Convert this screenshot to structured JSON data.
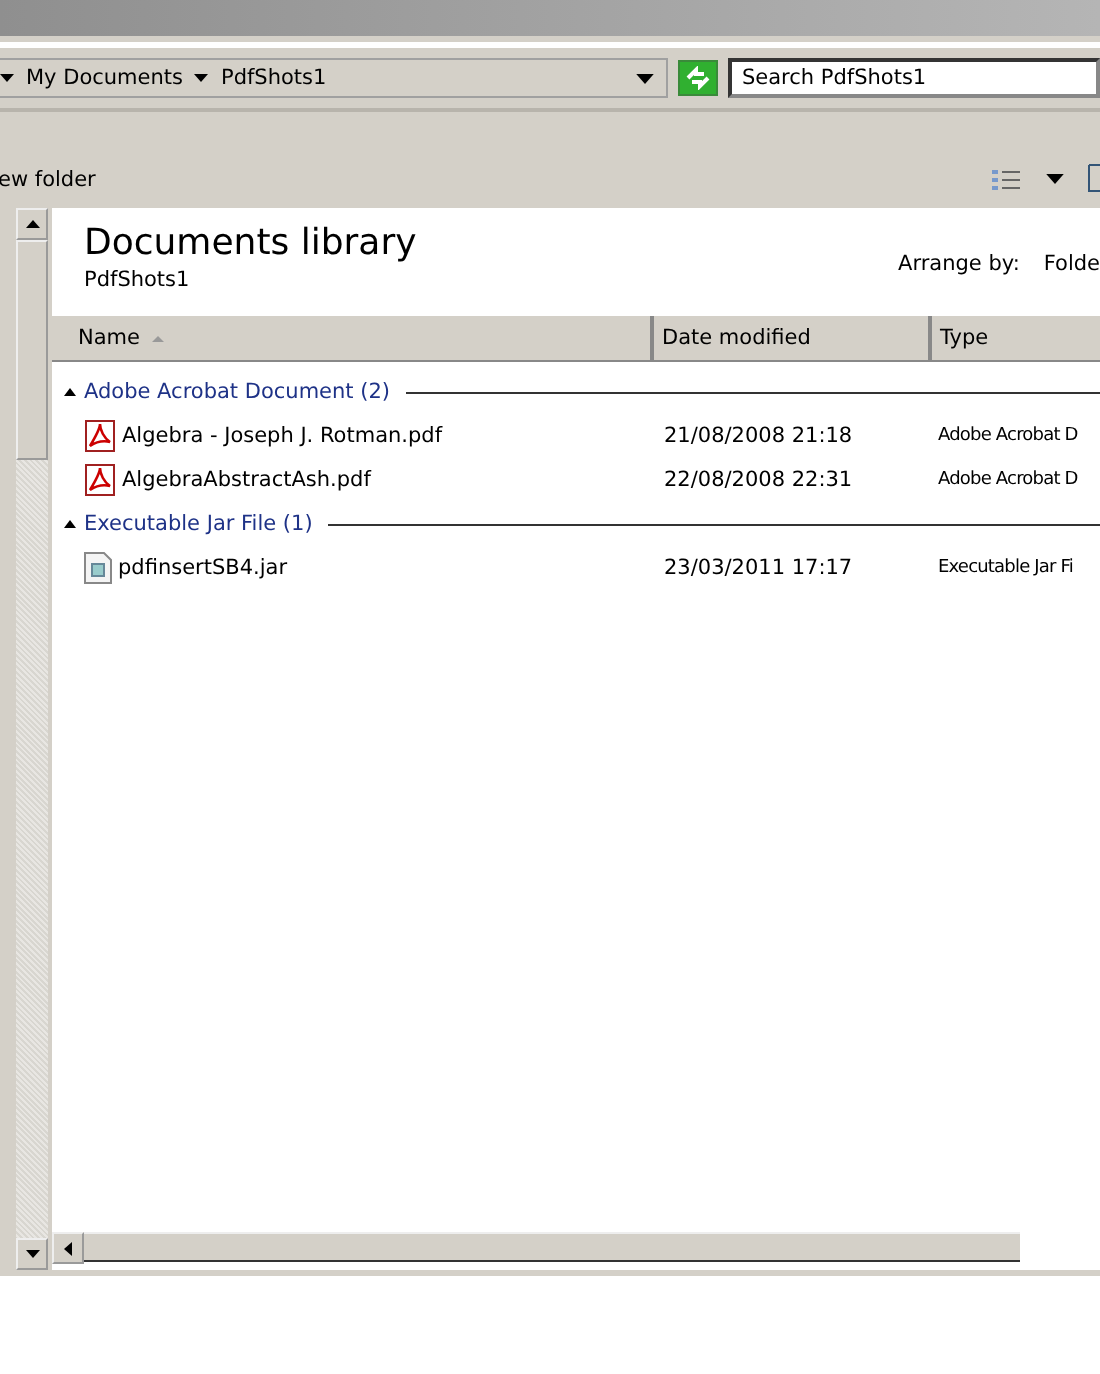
{
  "address_bar": {
    "crumbs": [
      "My Documents",
      "PdfShots1"
    ]
  },
  "search": {
    "placeholder": "Search PdfShots1"
  },
  "toolbar": {
    "new_folder": "ew folder"
  },
  "library": {
    "title": "Documents library",
    "subtitle": "PdfShots1",
    "arrange_label": "Arrange by:",
    "arrange_value": "Folde"
  },
  "columns": [
    "Name",
    "Date modified",
    "Type"
  ],
  "groups": [
    {
      "label": "Adobe Acrobat Document (2)",
      "expanded": true,
      "files": [
        {
          "kind": "pdf",
          "name": "Algebra - Joseph J. Rotman.pdf",
          "date": "21/08/2008 21:18",
          "type": "Adobe Acrobat D"
        },
        {
          "kind": "pdf",
          "name": "AlgebraAbstractAsh.pdf",
          "date": "22/08/2008 22:31",
          "type": "Adobe Acrobat D"
        }
      ]
    },
    {
      "label": "Executable Jar File (1)",
      "expanded": true,
      "files": [
        {
          "kind": "jar",
          "name": "pdfinsertSB4.jar",
          "date": "23/03/2011 17:17",
          "type": "Executable Jar Fi"
        }
      ]
    }
  ]
}
